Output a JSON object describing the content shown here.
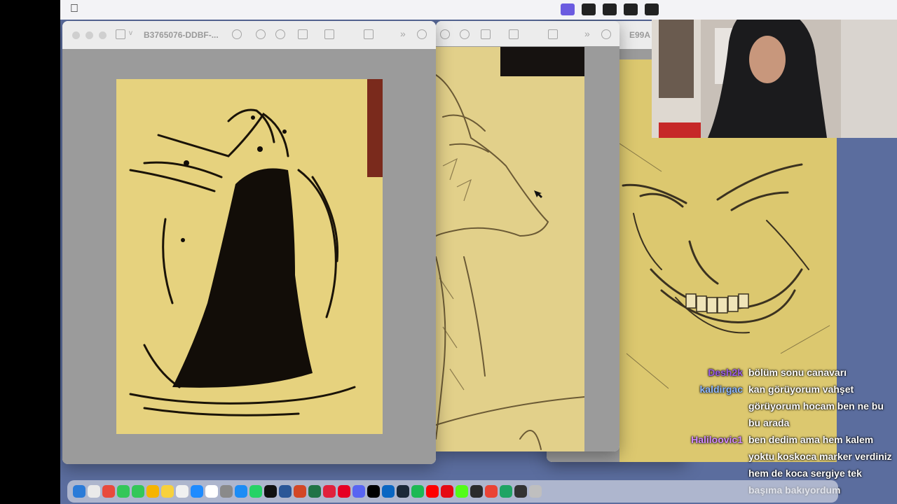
{
  "menubar": {
    "apple_icon": "apple-logo-icon"
  },
  "window_left": {
    "title": "B3765076-DDBF-..."
  },
  "window_middle": {
    "title": ""
  },
  "window_right": {
    "title": "E99A"
  },
  "chat": {
    "messages": [
      {
        "user": "Desh2k",
        "user_color": "#9b5de5",
        "text": "bölüm sonu canavarı"
      },
      {
        "user": "kaldirgac",
        "user_color": "#8fb9ff",
        "text": "kan görüyorum vahşet görüyorum hocam ben ne bu bu arada"
      },
      {
        "user": "Haliloovic1",
        "user_color": "#d48cff",
        "text": "ben dedim ama hem kalem yoktu koskoca marker verdiniz hem de koca sergiye tek başıma bakıyordum"
      }
    ]
  },
  "dock": {
    "icons": [
      "finder-icon",
      "launchpad-icon",
      "chrome-icon",
      "messages-icon",
      "facetime-icon",
      "photos-icon",
      "notes-icon",
      "reminders-icon",
      "safari-icon",
      "calendar-icon",
      "settings-icon",
      "appstore-icon",
      "whatsapp-icon",
      "capcut-icon",
      "word-icon",
      "powerpoint-icon",
      "excel-icon",
      "opera-icon",
      "pinterest-icon",
      "discord-icon",
      "x-icon",
      "linkedin-icon",
      "steam-icon",
      "spotify-icon",
      "youtube-icon",
      "netflix-icon",
      "kick-icon",
      "obs-icon",
      "gmail-icon",
      "drive-icon",
      "terminal-icon",
      "trash-icon"
    ],
    "colors": [
      "#2b7bd8",
      "#eaeaea",
      "#e84a3c",
      "#34c759",
      "#34c759",
      "#f5b400",
      "#f7d13d",
      "#f0f0f0",
      "#1e8bff",
      "#ffffff",
      "#8a8a8a",
      "#1c8cf5",
      "#25d366",
      "#111111",
      "#2b5797",
      "#d24726",
      "#217346",
      "#e0203c",
      "#e60023",
      "#5865f2",
      "#000000",
      "#0a66c2",
      "#1b2838",
      "#1db954",
      "#ff0000",
      "#e50914",
      "#53fc18",
      "#2b2b2b",
      "#ea4335",
      "#1fa463",
      "#333333",
      "#bfbfbf"
    ]
  }
}
